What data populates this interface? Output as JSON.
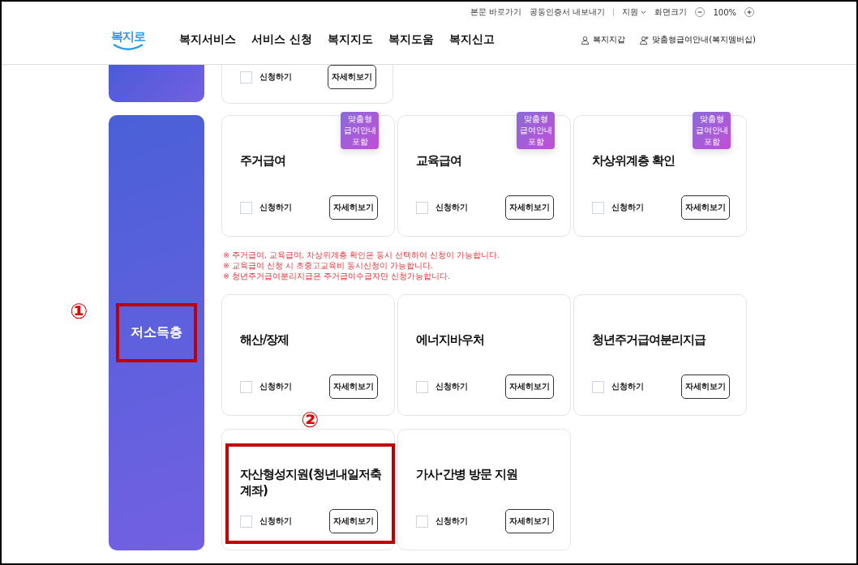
{
  "utility_links": [
    "본문 바로가기",
    "공동인증서 내보내기"
  ],
  "support_menu": "지원",
  "zoom": {
    "label": "화면크기",
    "value": "100%"
  },
  "logo": "복지로",
  "nav": [
    "복지서비스",
    "서비스 신청",
    "복지지도",
    "복지도움",
    "복지신고"
  ],
  "user_links": [
    {
      "kind": "person",
      "label": "복지지갑"
    },
    {
      "kind": "person-add",
      "label": "맞춤형급여안내(복지멤버십)"
    }
  ],
  "top_partial_card": {
    "checkbox_label": "신청하기",
    "checked": false,
    "button": "자세히보기"
  },
  "section": {
    "category": "저소득층",
    "category_annotation": "①",
    "blocks": [
      {
        "kind": "cards",
        "cards": [
          {
            "title": "주거급여",
            "badge": "맞춤형 급여안내 포함",
            "checkbox_label": "신청하기",
            "checked": false,
            "button": "자세히보기"
          },
          {
            "title": "교육급여",
            "badge": "맞춤형 급여안내 포함",
            "checkbox_label": "신청하기",
            "checked": false,
            "button": "자세히보기"
          },
          {
            "title": "차상위계층 확인",
            "badge": "맞춤형 급여안내 포함",
            "checkbox_label": "신청하기",
            "checked": false,
            "button": "자세히보기"
          }
        ]
      },
      {
        "kind": "notes",
        "notes": [
          "※ 주거급여, 교육급여, 차상위계층 확인은 동시 선택하여 신청이 가능합니다.",
          "※ 교육급여 신청 시 초중고교육비 동시신청이 가능합니다.",
          "※ 청년주거급여분리지급은 주거급여수급자만 신청가능합니다."
        ]
      },
      {
        "kind": "cards",
        "cards": [
          {
            "title": "해산/장제",
            "checkbox_label": "신청하기",
            "checked": false,
            "button": "자세히보기"
          },
          {
            "title": "에너지바우처",
            "checkbox_label": "신청하기",
            "checked": false,
            "button": "자세히보기"
          },
          {
            "title": "청년주거급여분리지급",
            "checkbox_label": "신청하기",
            "checked": false,
            "button": "자세히보기"
          }
        ]
      },
      {
        "kind": "cards",
        "cards": [
          {
            "title": "자산형성지원(청년내일저축계좌)",
            "annotation": "②",
            "checkbox_label": "신청하기",
            "checked": false,
            "button": "자세히보기"
          },
          {
            "title": "가사·간병 방문 지원",
            "checkbox_label": "신청하기",
            "checked": false,
            "button": "자세히보기"
          }
        ]
      }
    ]
  }
}
